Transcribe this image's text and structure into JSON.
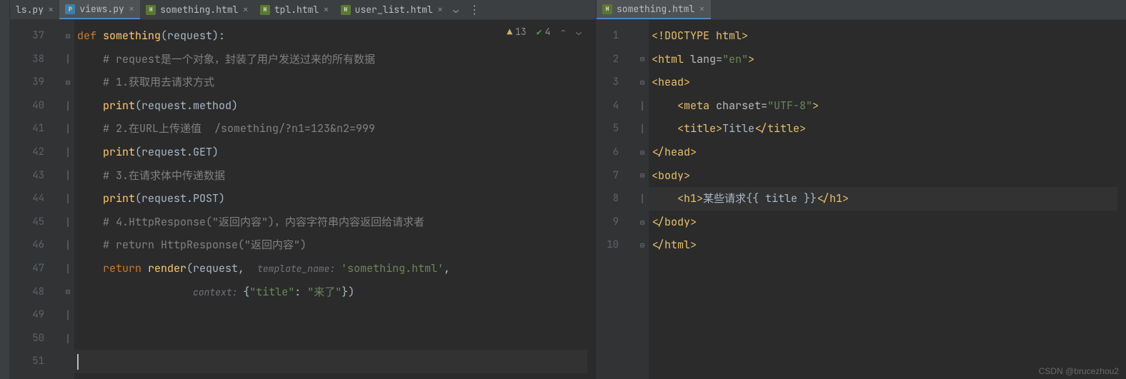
{
  "left": {
    "tabs": [
      {
        "label": "ls.py",
        "icon": "py",
        "active": false
      },
      {
        "label": "views.py",
        "icon": "py",
        "active": true
      },
      {
        "label": "something.html",
        "icon": "html",
        "active": false
      },
      {
        "label": "tpl.html",
        "icon": "html",
        "active": false
      },
      {
        "label": "user_list.html",
        "icon": "html",
        "active": false
      }
    ],
    "status": {
      "warnings": "13",
      "checks": "4"
    },
    "lines": [
      "37",
      "38",
      "39",
      "40",
      "41",
      "42",
      "43",
      "44",
      "45",
      "46",
      "47",
      "48",
      "49",
      "50",
      "51"
    ],
    "code": {
      "l37_def": "def ",
      "l37_fn": "something",
      "l37_rest": "(request):",
      "l38": "# request是一个对象，封装了用户发送过来的所有数据",
      "l39": "# 1.获取用去请求方式",
      "l40_print": "print",
      "l40_rest": "(request.method)",
      "l41": "# 2.在URL上传递值  /something/?n1=123&n2=999",
      "l42_print": "print",
      "l42_rest": "(request.GET)",
      "l43": "# 3.在请求体中传递数据",
      "l44_print": "print",
      "l44_rest": "(request.POST)",
      "l45": "# 4.HttpResponse(\"返回内容\")，内容字符串内容返回给请求者",
      "l46": "# return HttpResponse(\"返回内容\")",
      "l47_ret": "return ",
      "l47_fn": "render",
      "l47_a": "(request,  ",
      "l47_hint": "template_name: ",
      "l47_str": "'something.html'",
      "l47_comma": ",",
      "l48_hint": "context: ",
      "l48_a": "{",
      "l48_k": "\"title\"",
      "l48_b": ": ",
      "l48_v": "\"来了\"",
      "l48_c": "})"
    }
  },
  "right": {
    "tabs": [
      {
        "label": "something.html",
        "icon": "html",
        "active": true
      }
    ],
    "lines": [
      "1",
      "2",
      "3",
      "4",
      "5",
      "6",
      "7",
      "8",
      "9",
      "10"
    ],
    "code": {
      "l1": "<!DOCTYPE html>",
      "l2_a": "<html ",
      "l2_attr": "lang=",
      "l2_val": "\"en\"",
      "l2_b": ">",
      "l3": "<head>",
      "l4_a": "    <meta ",
      "l4_attr": "charset=",
      "l4_val": "\"UTF-8\"",
      "l4_b": ">",
      "l5_a": "    <title>",
      "l5_t": "Title",
      "l5_b": "</title>",
      "l6": "</head>",
      "l7": "<body>",
      "l8_a": "    <h1>",
      "l8_t": "某些请求{{ title }}",
      "l8_b": "</h1>",
      "l9": "</body>",
      "l10": "</html>"
    }
  },
  "watermark": "CSDN @brucezhou2"
}
